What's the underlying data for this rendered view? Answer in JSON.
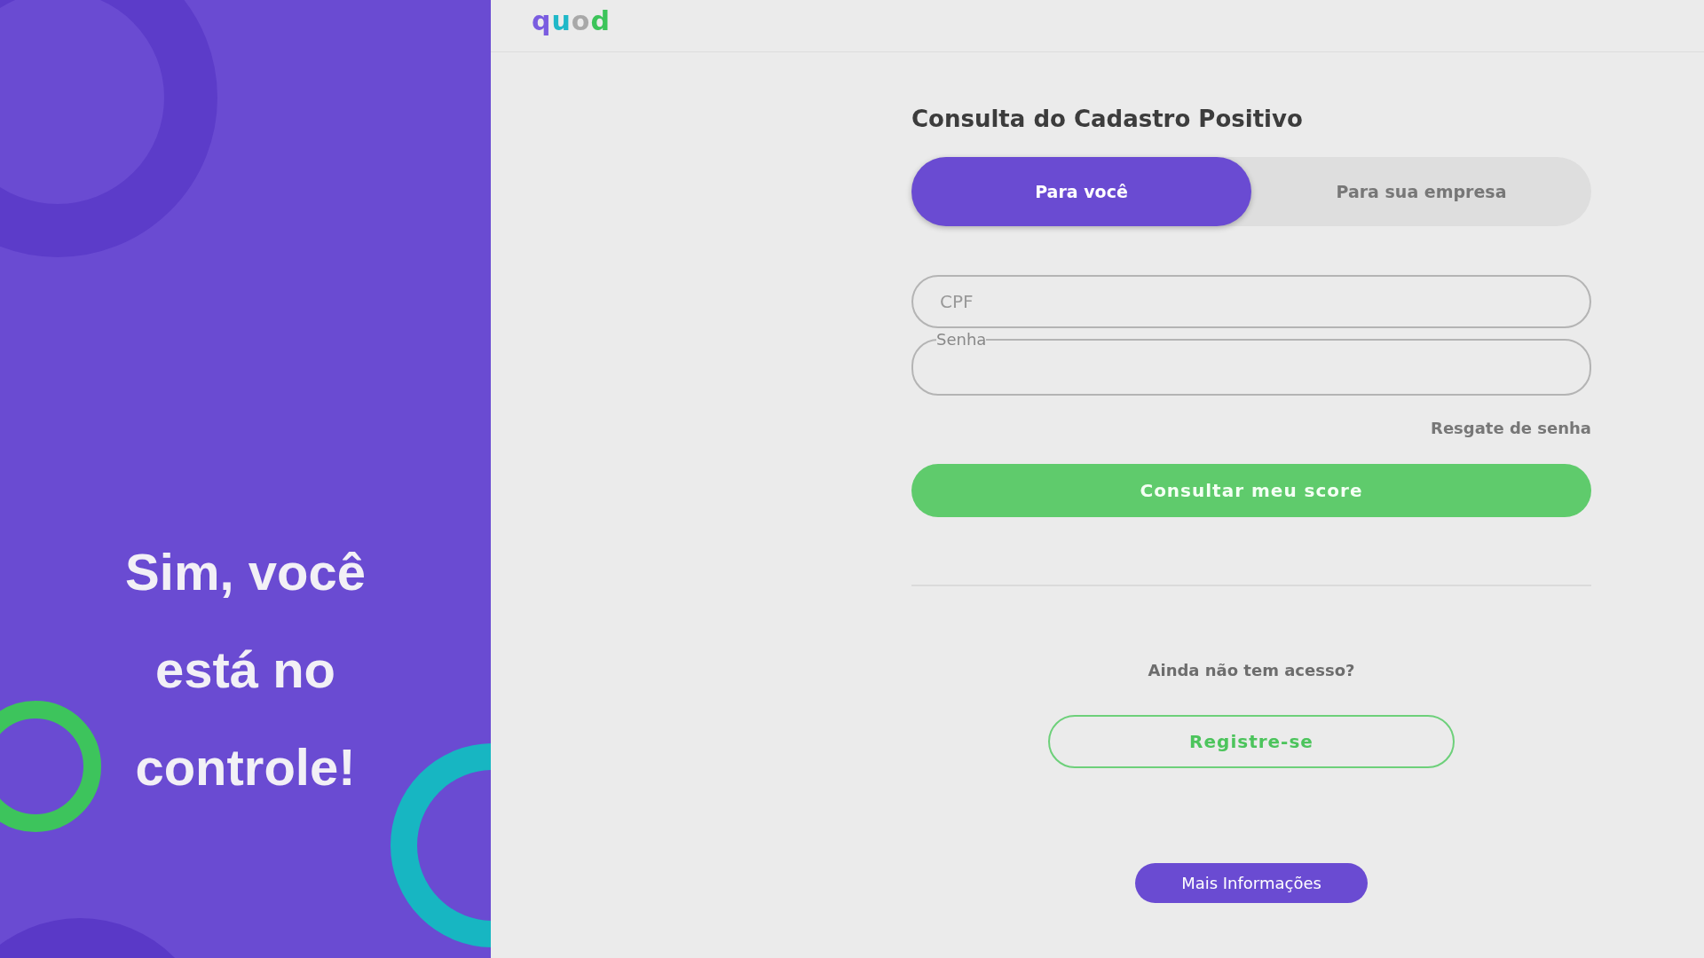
{
  "logo": "quod",
  "hero": {
    "text": "Sim, você está no controle!"
  },
  "form": {
    "title": "Consulta do Cadastro Positivo",
    "tabs": [
      {
        "label": "Para você",
        "selected": true
      },
      {
        "label": "Para sua empresa",
        "selected": false
      }
    ],
    "cpf_field": {
      "placeholder": "CPF"
    },
    "password_field": {
      "label": "Senha"
    },
    "forgot_link": "Resgate de senha",
    "submit_button": "Consultar meu score",
    "signup_prompt": "Ainda não tem acesso?",
    "signup_button": "Registre-se",
    "more_info_button": "Mais Informações"
  }
}
